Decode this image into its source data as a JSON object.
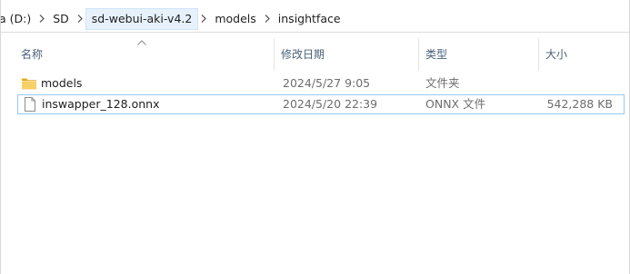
{
  "breadcrumb": {
    "items": [
      {
        "label": "a (D:)"
      },
      {
        "label": "SD"
      },
      {
        "label": "sd-webui-aki-v4.2"
      },
      {
        "label": "models"
      },
      {
        "label": "insightface"
      }
    ]
  },
  "columns": {
    "name": "名称",
    "modified": "修改日期",
    "type": "类型",
    "size": "大小"
  },
  "files": [
    {
      "name": "models",
      "modified": "2024/5/27 9:05",
      "type": "文件夹",
      "size": "",
      "icon": "folder-icon",
      "selected": false
    },
    {
      "name": "inswapper_128.onnx",
      "modified": "2024/5/20 22:39",
      "type": "ONNX 文件",
      "size": "542,288 KB",
      "icon": "file-icon",
      "selected": true
    }
  ],
  "colors": {
    "folder": "#f5c344",
    "selection_border": "#99c9ef",
    "active_crumb": "#e6f1fb",
    "header_text": "#4c607a"
  }
}
